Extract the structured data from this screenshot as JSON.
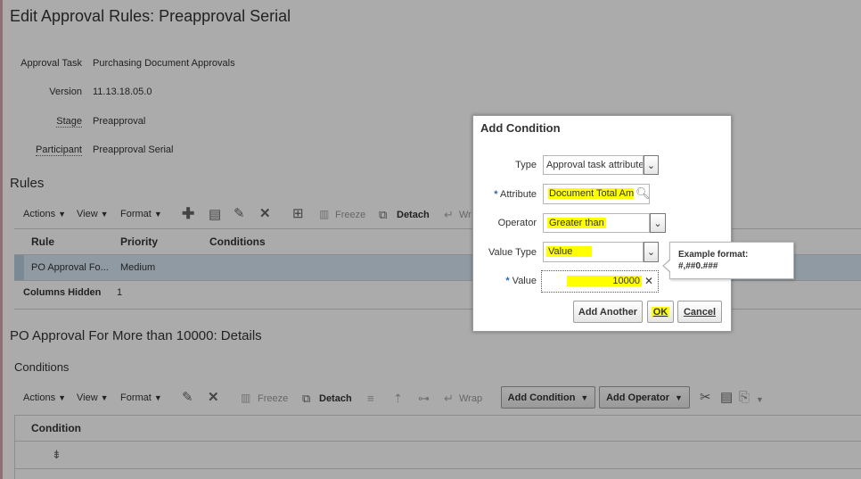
{
  "page": {
    "title": "Edit Approval Rules: Preapproval Serial",
    "approval_task_label": "Approval Task",
    "approval_task_value": "Purchasing Document Approvals",
    "version_label": "Version",
    "version_value": "11.13.18.05.0",
    "stage_label": "Stage",
    "stage_value": "Preapproval",
    "participant_label": "Participant",
    "participant_value": "Preapproval Serial"
  },
  "rules": {
    "heading": "Rules",
    "toolbar": {
      "actions": "Actions",
      "view": "View",
      "format": "Format",
      "freeze": "Freeze",
      "detach": "Detach",
      "wrap_partial": "Wr"
    },
    "columns": [
      "Rule",
      "Priority",
      "Conditions"
    ],
    "row": {
      "rule": "PO Approval Fo...",
      "priority": "Medium",
      "conditions": ""
    },
    "columns_hidden_label": "Columns Hidden",
    "columns_hidden_value": "1"
  },
  "details": {
    "heading": "PO Approval For More than 10000: Details",
    "conditions_heading": "Conditions",
    "toolbar": {
      "actions": "Actions",
      "view": "View",
      "format": "Format",
      "freeze": "Freeze",
      "detach": "Detach",
      "wrap": "Wrap",
      "add_condition": "Add Condition",
      "add_operator": "Add Operator"
    },
    "column": "Condition"
  },
  "dialog": {
    "title": "Add Condition",
    "type_label": "Type",
    "type_value": "Approval task attribute",
    "attribute_label": "Attribute",
    "attribute_value": "Document Total Am",
    "operator_label": "Operator",
    "operator_value": "Greater than",
    "value_type_label": "Value Type",
    "value_type_value": "Value",
    "value_label": "Value",
    "value_value": "10000",
    "add_another": "Add Another",
    "ok": "OK",
    "cancel": "Cancel",
    "required_marker": "*"
  },
  "tooltip": {
    "line1": "Example format:",
    "line2": "#,##0.###"
  },
  "colors": {
    "highlight": "#ffff00",
    "overlay": "rgba(0,0,0,0.33)",
    "selected_row": "#d6e6f3"
  },
  "icons": [
    "plus-icon",
    "table-icon",
    "pencil-icon",
    "delete-x-icon",
    "freeze-icon",
    "detach-icon",
    "wrap-icon",
    "search-icon",
    "clear-icon",
    "chevron-down-icon",
    "scissors-icon",
    "copy-icon",
    "paste-icon",
    "filter-icon"
  ]
}
